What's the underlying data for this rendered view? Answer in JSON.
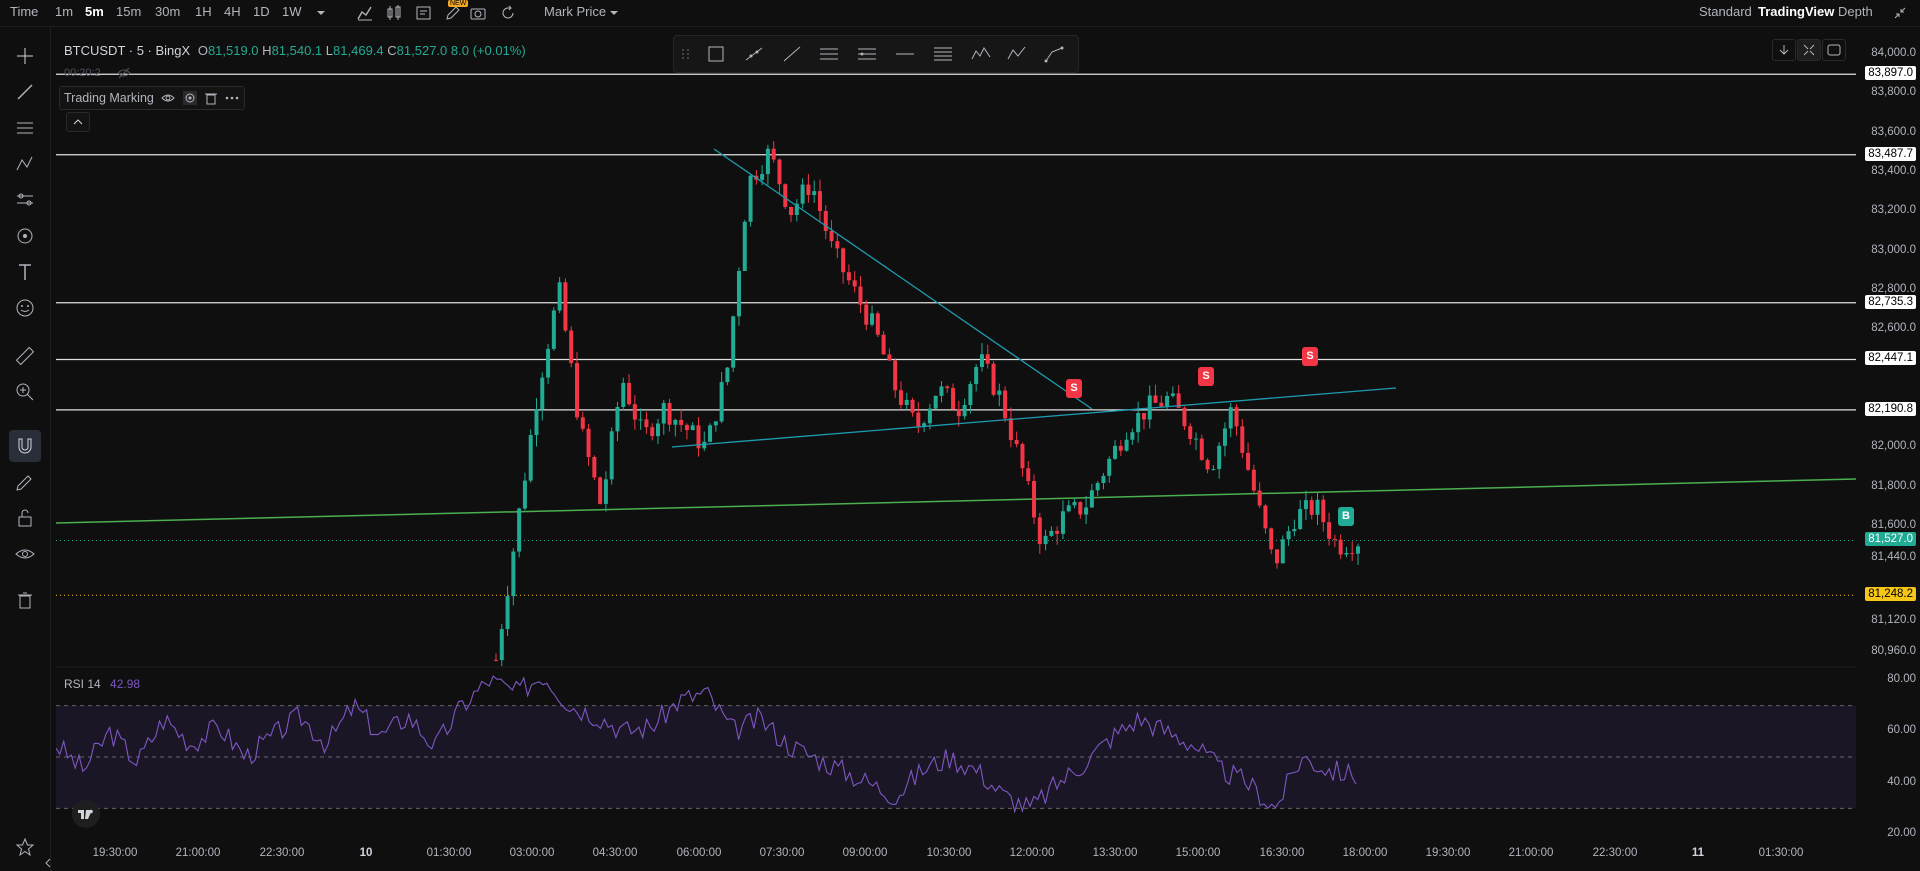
{
  "topbar": {
    "left": [
      "Time",
      "1m",
      "5m",
      "15m",
      "30m",
      "1H",
      "4H",
      "1D",
      "1W"
    ],
    "active": "5m",
    "new_badge": "NEW",
    "price_type": "Mark Price",
    "right": [
      "Standard",
      "TradingView",
      "Depth"
    ],
    "right_active": "TradingView"
  },
  "legend": {
    "symbol": "BTCUSDT · 5 · BingX",
    "o_label": "O",
    "o": "81,519.0",
    "h_label": "H",
    "h": "81,540.1",
    "l_label": "L",
    "l": "81,469.4",
    "c_label": "C",
    "c": "81,527.0",
    "change": "8.0 (+0.01%)",
    "sub": "00:20:2"
  },
  "trading_marking": {
    "label": "Trading Marking"
  },
  "price_axis": {
    "labels": [
      "84,000.0",
      "83,800.0",
      "83,600.0",
      "83,400.0",
      "83,200.0",
      "83,000.0",
      "82,800.0",
      "82,600.0",
      "82,000.0",
      "81,800.0",
      "81,600.0",
      "81,440.0",
      "81,120.0",
      "80,960.0"
    ],
    "tags": [
      {
        "text": "83,897.0",
        "kind": "line"
      },
      {
        "text": "83,487.7",
        "kind": "line"
      },
      {
        "text": "82,735.3",
        "kind": "line"
      },
      {
        "text": "82,447.1",
        "kind": "line"
      },
      {
        "text": "82,190.8",
        "kind": "line"
      },
      {
        "text": "81,527.0",
        "kind": "last"
      },
      {
        "text": "81,248.2",
        "kind": "yellow"
      }
    ]
  },
  "rsi": {
    "label": "RSI 14",
    "value": "42.98",
    "axis": [
      "80.00",
      "60.00",
      "40.00",
      "20.00"
    ]
  },
  "time_axis": [
    "19:30:00",
    "21:00:00",
    "22:30:00",
    "10",
    "01:30:00",
    "03:00:00",
    "04:30:00",
    "06:00:00",
    "07:30:00",
    "09:00:00",
    "10:30:00",
    "12:00:00",
    "13:30:00",
    "15:00:00",
    "16:30:00",
    "18:00:00",
    "19:30:00",
    "21:00:00",
    "22:30:00",
    "11",
    "01:30:00"
  ],
  "markers": [
    {
      "text": "S",
      "kind": "sell"
    },
    {
      "text": "S",
      "kind": "sell"
    },
    {
      "text": "S",
      "kind": "sell"
    },
    {
      "text": "B",
      "kind": "buy"
    }
  ],
  "colors": {
    "up": "#22ab94",
    "down": "#f23645",
    "trend": "#1e9bb0",
    "support": "#4caf50",
    "rsi": "#7e57c2",
    "last_price": "#22ab94",
    "yellow_tag": "#f5c518"
  },
  "chart_data": {
    "type": "candlestick",
    "ylim": [
      80900,
      84050
    ],
    "y_ticks": [
      84000,
      83800,
      83600,
      83400,
      83200,
      83000,
      82800,
      82600,
      82000,
      81800,
      81600,
      81440,
      81120,
      80960
    ],
    "horizontal_lines": [
      83897.0,
      83487.7,
      82735.3,
      82447.1,
      82190.8
    ],
    "last_price": 81527.0,
    "dotted_level": 81248.2,
    "close_path": [
      80920,
      81600,
      82300,
      82800,
      82100,
      81700,
      82350,
      82050,
      82200,
      82100,
      82000,
      82400,
      83350,
      83500,
      83200,
      83350,
      83000,
      82800,
      82600,
      82300,
      82100,
      82300,
      82200,
      82450,
      82250,
      81900,
      81500,
      81650,
      81700,
      81900,
      82100,
      82200,
      82250,
      82100,
      81900,
      82200,
      81800,
      81400,
      81650,
      81700,
      81500,
      81527
    ],
    "rsi": {
      "range": [
        20,
        85
      ],
      "levels": [
        70,
        50,
        30
      ],
      "last": 42.98
    }
  }
}
